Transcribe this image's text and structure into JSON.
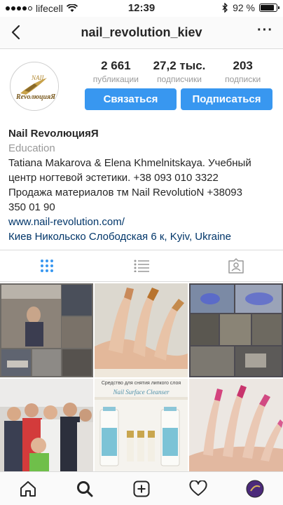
{
  "status_bar": {
    "carrier": "lifecell",
    "time": "12:39",
    "battery_percent": "92 %",
    "battery_level": 0.92,
    "signal_dots_filled": 4,
    "signal_dots_total": 5
  },
  "header": {
    "username": "nail_revolution_kiev",
    "back_icon": "chevron-left-icon",
    "more_icon": "more-dots-icon"
  },
  "profile": {
    "avatar_text_top": "NAIL",
    "avatar_text_bottom": "RevoлюцияЯ",
    "stats": [
      {
        "value": "2 661",
        "label": "публикации"
      },
      {
        "value": "27,2 тыс.",
        "label": "подписчики"
      },
      {
        "value": "203",
        "label": "подписки"
      }
    ],
    "contact_label": "Связаться",
    "follow_label": "Подписаться"
  },
  "bio": {
    "name": "Nail RevoлюцияЯ",
    "category": "Education",
    "line1": "Tatiana Makarova & Elena Khmelnitskaya. Учебный",
    "line2": "центр ногтевой эстетики. +38 093 010 3322",
    "line3": "Продажа материалов тм Nail RevolutioN +38093",
    "line4": "350 01 90",
    "website": "www.nail-revolution.com/",
    "address": "Киев Никольско Слободская 6 к, Kyiv, Ukraine"
  },
  "tabs": [
    {
      "icon": "grid-icon",
      "active": true
    },
    {
      "icon": "list-icon",
      "active": false
    },
    {
      "icon": "tagged-icon",
      "active": false
    }
  ],
  "grid_posts": [
    {
      "desc": "classroom collage"
    },
    {
      "desc": "manicured hand close-up"
    },
    {
      "desc": "workshop collage"
    },
    {
      "desc": "group of women"
    },
    {
      "desc": "Nail Surface Cleanser product",
      "caption_top": "Средство для снятия липкого слоя",
      "caption_brand": "Nail Surface Cleanser"
    },
    {
      "desc": "pink ombre nails"
    }
  ],
  "bottom_nav": [
    {
      "icon": "home-icon"
    },
    {
      "icon": "search-icon"
    },
    {
      "icon": "add-post-icon"
    },
    {
      "icon": "heart-icon"
    },
    {
      "icon": "profile-icon"
    }
  ],
  "colors": {
    "button_blue": "#3897f0",
    "link_navy": "#003569",
    "tab_active": "#3897f0"
  }
}
